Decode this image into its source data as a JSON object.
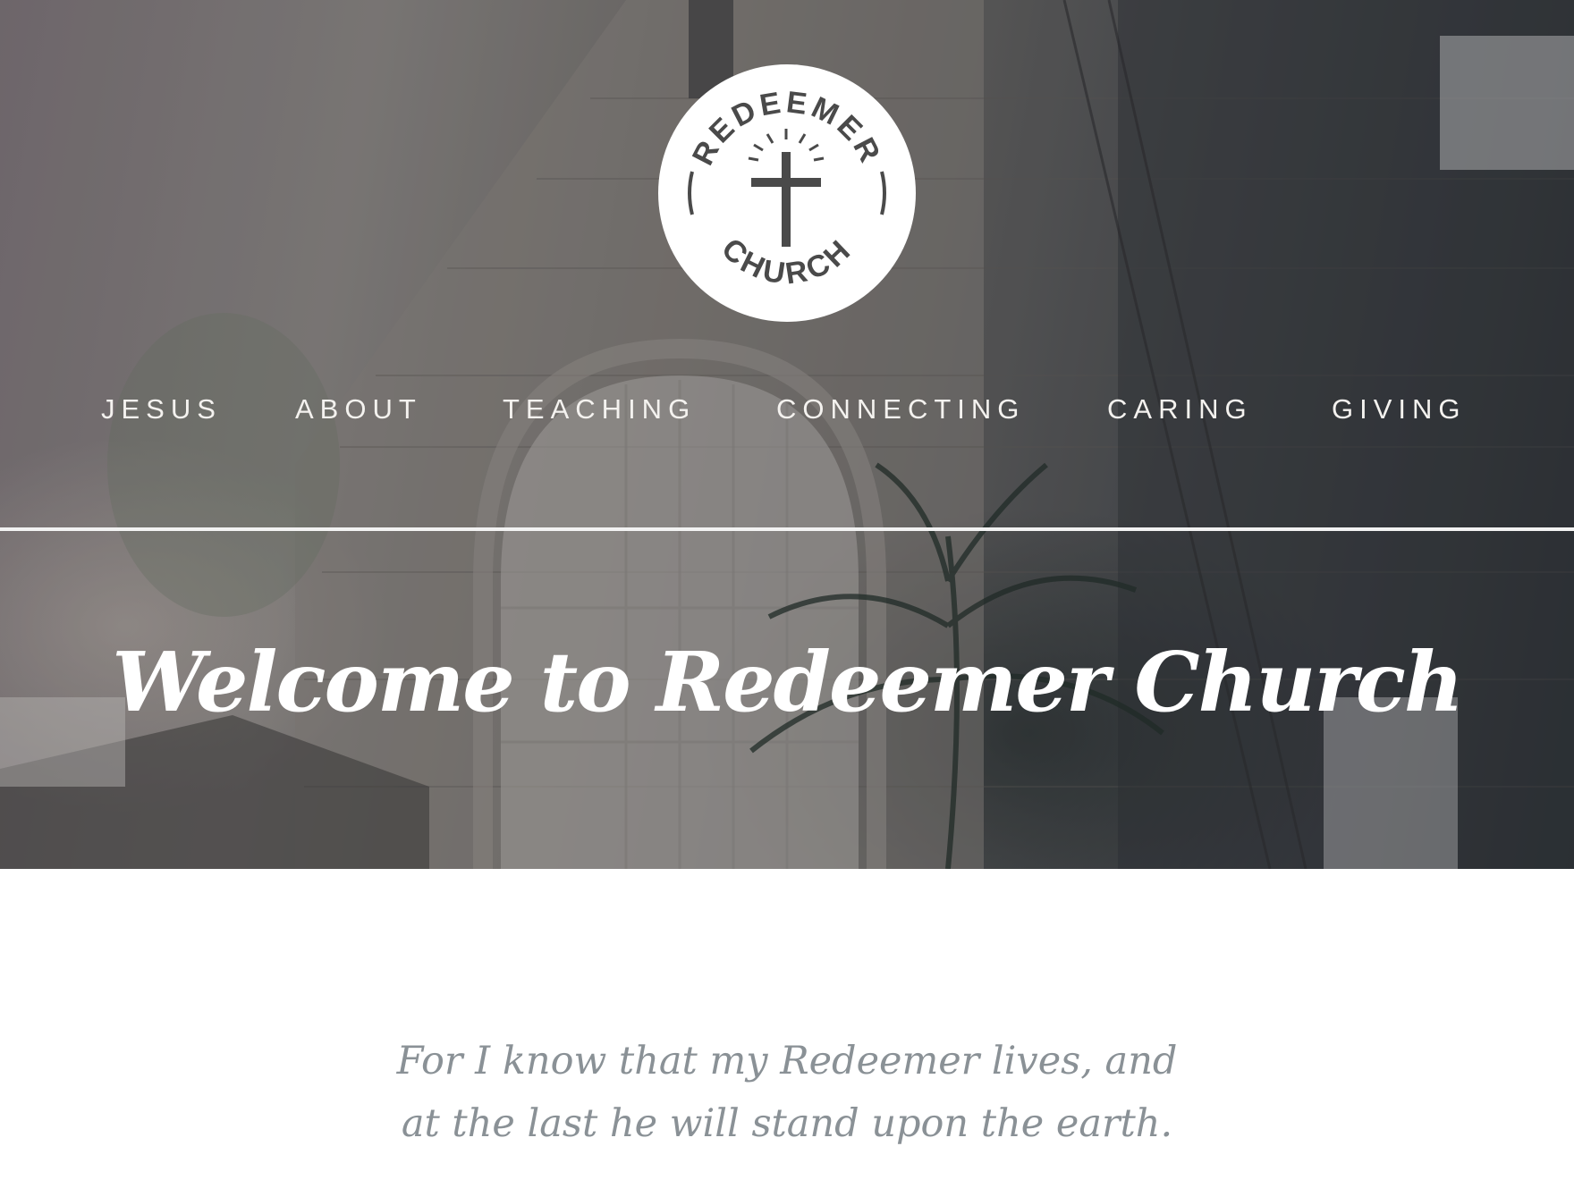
{
  "logo": {
    "top_text": "REDEEMER",
    "bottom_text": "CHURCH",
    "icon": "cross-icon"
  },
  "nav": {
    "items": [
      {
        "label": "JESUS"
      },
      {
        "label": "ABOUT"
      },
      {
        "label": "TEACHING"
      },
      {
        "label": "CONNECTING"
      },
      {
        "label": "CARING"
      },
      {
        "label": "GIVING"
      }
    ]
  },
  "hero": {
    "heading": "Welcome to Redeemer Church"
  },
  "verse": {
    "line1": "For I know that my Redeemer lives, and",
    "line2": "at the last he will stand upon the earth."
  },
  "colors": {
    "nav_text": "#f4f2ef",
    "heading": "#ffffff",
    "verse_text": "#8a9196",
    "logo_fill": "#ffffff",
    "logo_ink": "#4a4a4a"
  }
}
